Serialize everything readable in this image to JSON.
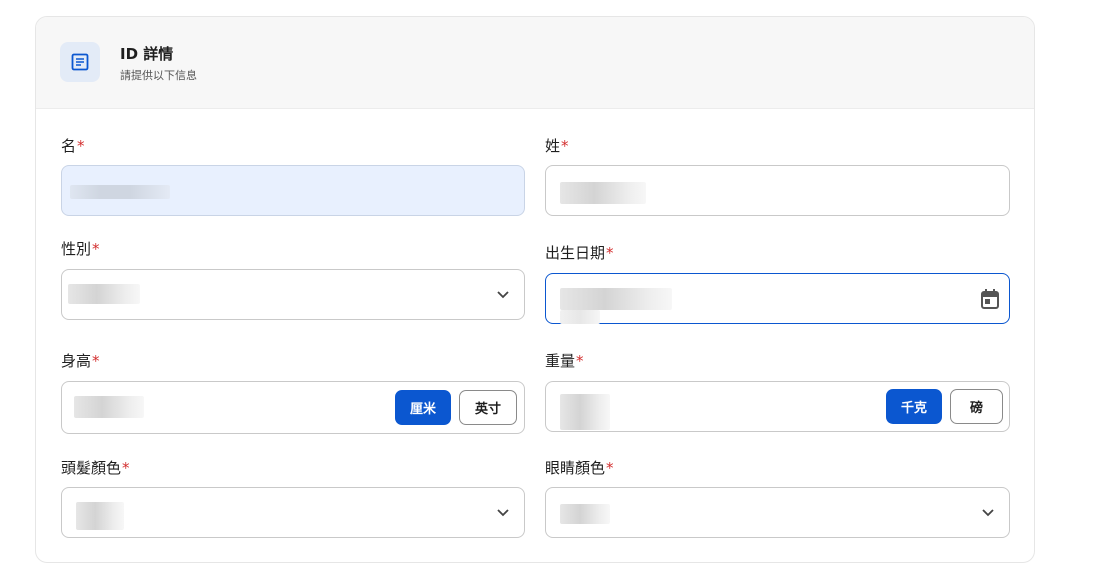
{
  "header": {
    "title": "ID 詳情",
    "subtitle": "請提供以下信息",
    "icon": "document-icon"
  },
  "required_marker": "*",
  "fields": {
    "first_name": {
      "label": "名"
    },
    "last_name": {
      "label": "姓"
    },
    "gender": {
      "label": "性別"
    },
    "birth_date": {
      "label": "出生日期"
    },
    "height": {
      "label": "身高",
      "units": [
        "厘米",
        "英寸"
      ],
      "selected_unit": "厘米"
    },
    "weight": {
      "label": "重量",
      "units": [
        "千克",
        "磅"
      ],
      "selected_unit": "千克"
    },
    "hair_color": {
      "label": "頭髮顏色"
    },
    "eye_color": {
      "label": "眼睛顏色"
    }
  },
  "colors": {
    "accent": "#0b57d0",
    "required": "#d32f2f",
    "autofill_bg": "#e8f0fe",
    "header_bg": "#f7f7f7",
    "icon_bg": "#e3ebf7"
  }
}
